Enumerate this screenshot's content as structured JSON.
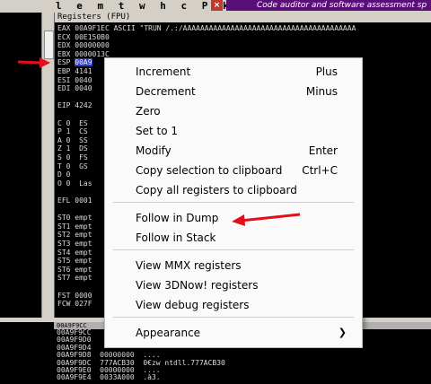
{
  "toolbar": {
    "letters": "l e m t w h c P k b z r ... s",
    "close_glyph": "×",
    "banner_text": "Code auditor and software assessment sp"
  },
  "registers": {
    "title": "Registers (FPU)",
    "lines": [
      "EAX 00A9F1EC ASCII \"TRUN /.:/AAAAAAAAAAAAAAAAAAAAAAAAAAAAAAAAAAAAAAAA",
      "ECX 00E150B0",
      "EDX 00000000",
      "EBX 0000013C",
      "ESP 00A9",
      "EBP 4141",
      "ESI 0040",
      "EDI 0040",
      "",
      "EIP 4242",
      "",
      "C 0  ES",
      "P 1  CS",
      "A 0  SS",
      "Z 1  DS",
      "S 0  FS",
      "T 0  GS",
      "D 0",
      "O 0  Las",
      "",
      "EFL 0001",
      "",
      "ST0 empt",
      "ST1 empt",
      "ST2 empt",
      "ST3 empt",
      "ST4 empt",
      "ST5 empt",
      "ST6 empt",
      "ST7 empt",
      "",
      "FST 0000",
      "FCW 027F"
    ]
  },
  "dump": {
    "title": "00A9F9CC",
    "lines": [
      "00A9F9CC",
      "00A9F9D0",
      "00A9F9D4",
      "00A9F9D8  00000000  ....",
      "00A9F9DC  777ACB30  0€zw ntdll.777ACB30",
      "00A9F9E0  00000000  ....",
      "00A9F9E4  0033A000  .à3."
    ]
  },
  "context_menu": {
    "items": [
      {
        "label": "Increment",
        "shortcut": "Plus"
      },
      {
        "label": "Decrement",
        "shortcut": "Minus"
      },
      {
        "label": "Zero",
        "shortcut": ""
      },
      {
        "label": "Set to 1",
        "shortcut": ""
      },
      {
        "label": "Modify",
        "shortcut": "Enter"
      },
      {
        "label": "Copy selection to clipboard",
        "shortcut": "Ctrl+C"
      },
      {
        "label": "Copy all registers to clipboard",
        "shortcut": ""
      },
      {
        "label": "Follow in Dump",
        "shortcut": ""
      },
      {
        "label": "Follow in Stack",
        "shortcut": ""
      },
      {
        "label": "View MMX registers",
        "shortcut": ""
      },
      {
        "label": "View 3DNow! registers",
        "shortcut": ""
      },
      {
        "label": "View debug registers",
        "shortcut": ""
      },
      {
        "label": "Appearance",
        "shortcut": "",
        "submenu_glyph": "❯"
      }
    ]
  },
  "colors": {
    "annotation_arrow": "#e0101a",
    "highlight": "#2a35c8",
    "banner": "#5a0f78"
  }
}
